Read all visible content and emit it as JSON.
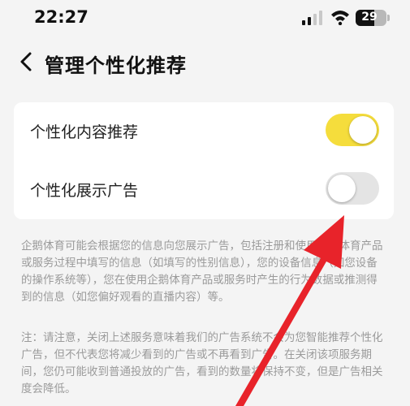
{
  "status_bar": {
    "time": "22:27",
    "battery": "29",
    "icons": [
      "signal-icon",
      "wifi-icon",
      "battery-icon"
    ]
  },
  "header": {
    "back_icon": "chevron-left-icon",
    "title": "管理个性化推荐"
  },
  "settings": [
    {
      "label": "个性化内容推荐",
      "enabled": true
    },
    {
      "label": "个性化展示广告",
      "enabled": false
    }
  ],
  "notes": [
    "企鹅体育可能会根据您的信息向您展示广告，包括注册和使用企鹅体育产品或服务过程中填写的信息（如填写的性别信息），您的设备信息（如您设备的操作系统等），您在使用企鹅体育产品或服务时产生的行为数据或推测得到的信息（如您偏好观看的直播内容）等。",
    "注：请注意，关闭上述服务意味着我们的广告系统不会为您智能推荐个性化广告，但不代表您将减少看到的广告或不再看到广告。在关闭该项服务期间，您仍可能收到普通投放的广告，看到的数量将保持不变，但是广告相关度会降低。"
  ],
  "colors": {
    "toggle_on": "#f5dd3c",
    "toggle_off": "#e4e4e4",
    "annotation_arrow": "#e8232a",
    "background": "#f4f4f4"
  }
}
